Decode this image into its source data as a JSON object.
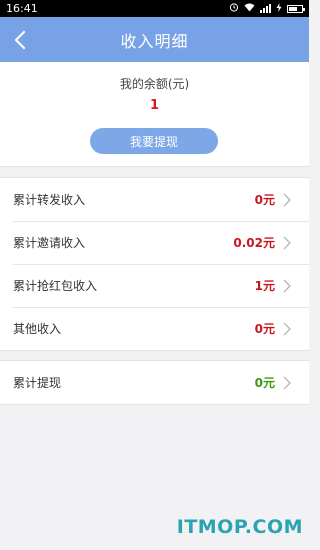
{
  "status_bar": {
    "time": "16:41"
  },
  "header": {
    "title": "收入明细"
  },
  "balance": {
    "label": "我的余额(元)",
    "value": "1",
    "withdraw_button": "我要提现"
  },
  "income_rows": [
    {
      "label": "累计转发收入",
      "value": "0元",
      "color": "#c8161d"
    },
    {
      "label": "累计邀请收入",
      "value": "0.02元",
      "color": "#c8161d"
    },
    {
      "label": "累计抢红包收入",
      "value": "1元",
      "color": "#c8161d"
    },
    {
      "label": "其他收入",
      "value": "0元",
      "color": "#c8161d"
    }
  ],
  "withdraw_row": {
    "label": "累计提现",
    "value": "0元",
    "color": "#3a9a12"
  },
  "watermark": "ITMOP.COM",
  "colors": {
    "header_bg": "#78a2e6",
    "button_bg": "#7ea7e8",
    "page_bg": "#f2f2f4"
  }
}
